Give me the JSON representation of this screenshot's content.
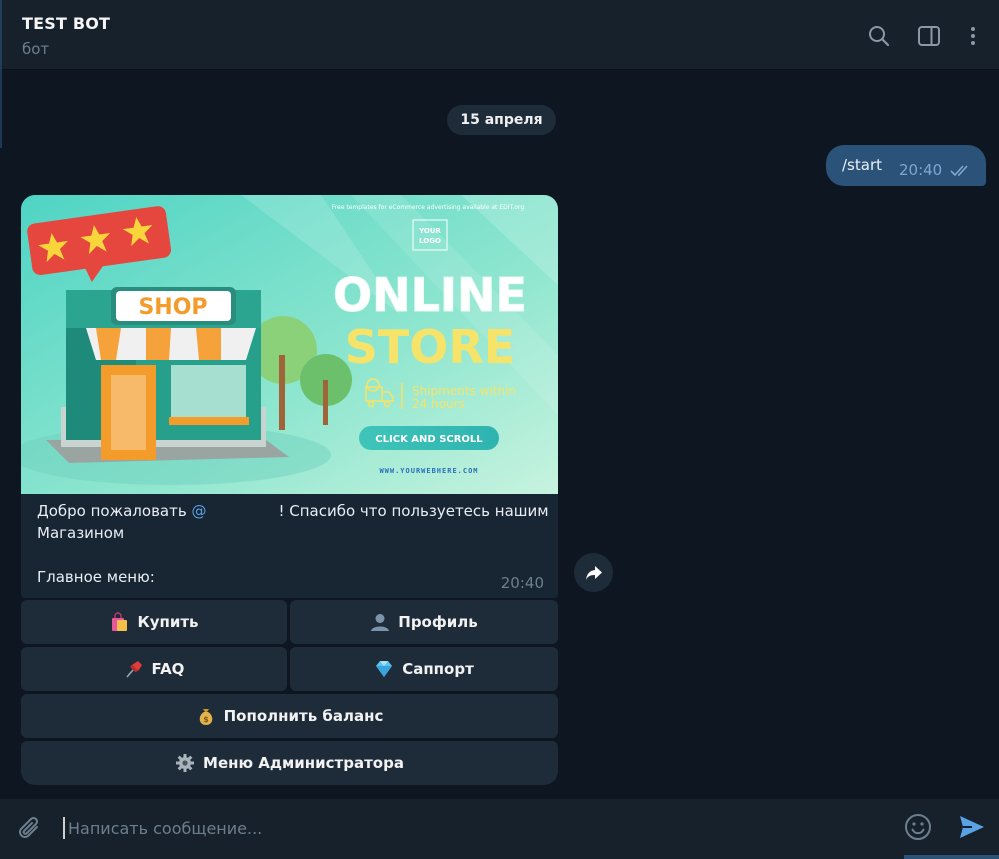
{
  "header": {
    "title": "TEST BOT",
    "subtitle": "бот"
  },
  "date_separator": "15 апреля",
  "outgoing": {
    "text": "/start",
    "time": "20:40"
  },
  "incoming": {
    "media": {
      "top_note": "Free templates for eCommerce advertising available at EDIT.org",
      "logo_line1": "YOUR",
      "logo_line2": "LOGO",
      "shop_sign": "SHOP",
      "headline1": "ONLINE",
      "headline2": "STORE",
      "shipments_line1": "Shipments within",
      "shipments_line2": "24 hours",
      "cta": "CLICK AND SCROLL",
      "website": "WWW.YOURWEBHERE.COM"
    },
    "caption_prefix": "Добро пожаловать ",
    "mention": "@",
    "caption_suffix": "! Спасибо что пользуетесь нашим",
    "caption_line2": "Магазином",
    "caption_line4": "Главное меню:",
    "time": "20:40"
  },
  "keyboard": {
    "buy": "Купить",
    "profile": "Профиль",
    "faq": "FAQ",
    "support": "Саппорт",
    "topup": "Пополнить баланс",
    "admin": "Меню Администратора"
  },
  "composer": {
    "placeholder": "Написать сообщение..."
  },
  "colors": {
    "background": "#0e1621",
    "header": "#17212b",
    "outgoing_bubble": "#2b5278",
    "incoming_bubble": "#182533",
    "accent": "#5aa2e6"
  }
}
